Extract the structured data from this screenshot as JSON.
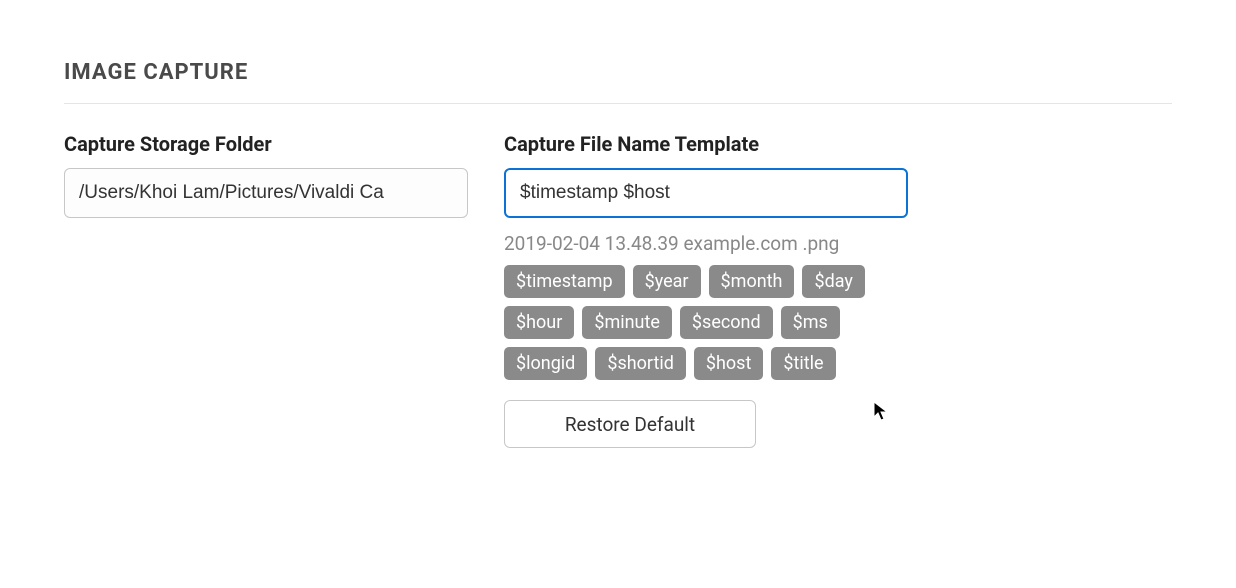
{
  "section_title": "IMAGE CAPTURE",
  "storage": {
    "label": "Capture Storage Folder",
    "value": "/Users/Khoi Lam/Pictures/Vivaldi Ca"
  },
  "template": {
    "label": "Capture File Name Template",
    "value": "$timestamp $host",
    "preview": "2019-02-04 13.48.39 example.com .png",
    "tags": [
      "$timestamp",
      "$year",
      "$month",
      "$day",
      "$hour",
      "$minute",
      "$second",
      "$ms",
      "$longid",
      "$shortid",
      "$host",
      "$title"
    ],
    "restore_label": "Restore Default"
  }
}
